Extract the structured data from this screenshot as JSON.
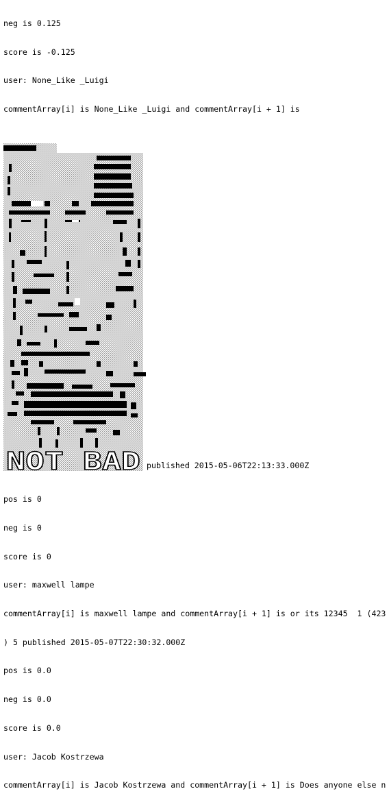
{
  "console": {
    "before": [
      "neg is 0.125",
      "score is -0.125",
      "user: None_Like _Luigi",
      "commentArray[i] is None_Like _Luigi and commentArray[i + 1] is"
    ],
    "art_caption": "NOT BAD",
    "published_text": "published 2015-05-06T22:13:33.000Z",
    "after": [
      "pos is 0",
      "neg is 0",
      "score is 0",
      "user: maxwell lampe",
      "commentArray[i] is maxwell lampe and commentArray[i + 1] is or its 12345  1 (423",
      ") 5 published 2015-05-07T22:30:32.000Z",
      "pos is 0.0",
      "neg is 0.0",
      "score is 0.0",
      "user: Jacob Kostrzewa",
      "commentArray[i] is Jacob Kostrzewa and commentArray[i + 1] is Does anyone else n"
    ]
  },
  "colors": {
    "background": "#ffffff",
    "text": "#000000",
    "shade": "#9a9a9a"
  }
}
